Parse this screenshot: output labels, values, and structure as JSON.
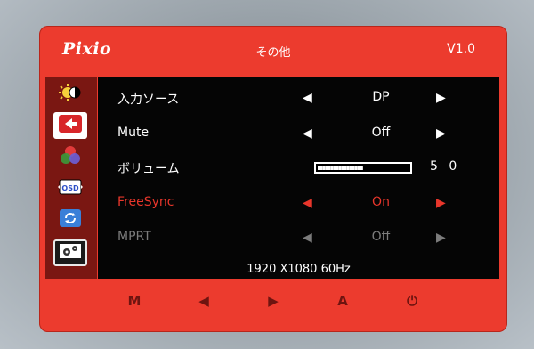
{
  "header": {
    "logo": "Pixio",
    "title": "その他",
    "version": "V1.0"
  },
  "sidebar": {
    "items": [
      {
        "icon": "brightness-contrast-icon",
        "selected": false
      },
      {
        "icon": "input-source-icon",
        "selected": false
      },
      {
        "icon": "color-icon",
        "selected": false
      },
      {
        "icon": "osd-icon",
        "selected": false
      },
      {
        "icon": "reset-icon",
        "selected": false
      },
      {
        "icon": "other-settings-icon",
        "selected": true
      }
    ]
  },
  "menu": {
    "input_source": {
      "label": "入力ソース",
      "value": "DP"
    },
    "mute": {
      "label": "Mute",
      "value": "Off"
    },
    "volume": {
      "label": "ボリューム",
      "value": "5 0",
      "level_fraction": 0.5
    },
    "freesync": {
      "label": "FreeSync",
      "value": "On"
    },
    "mprt": {
      "label": "MPRT",
      "value": "Off"
    },
    "arrow_left": "◀",
    "arrow_right": "▶"
  },
  "status": {
    "resolution": "1920 X1080  60Hz"
  },
  "buttons": {
    "menu": "M",
    "left": "◀",
    "right": "▶",
    "auto": "A",
    "power": "⏻"
  },
  "colors": {
    "accent": "#ec3b2e",
    "active_text": "#e8362b",
    "disabled_text": "#7c7c7c"
  }
}
